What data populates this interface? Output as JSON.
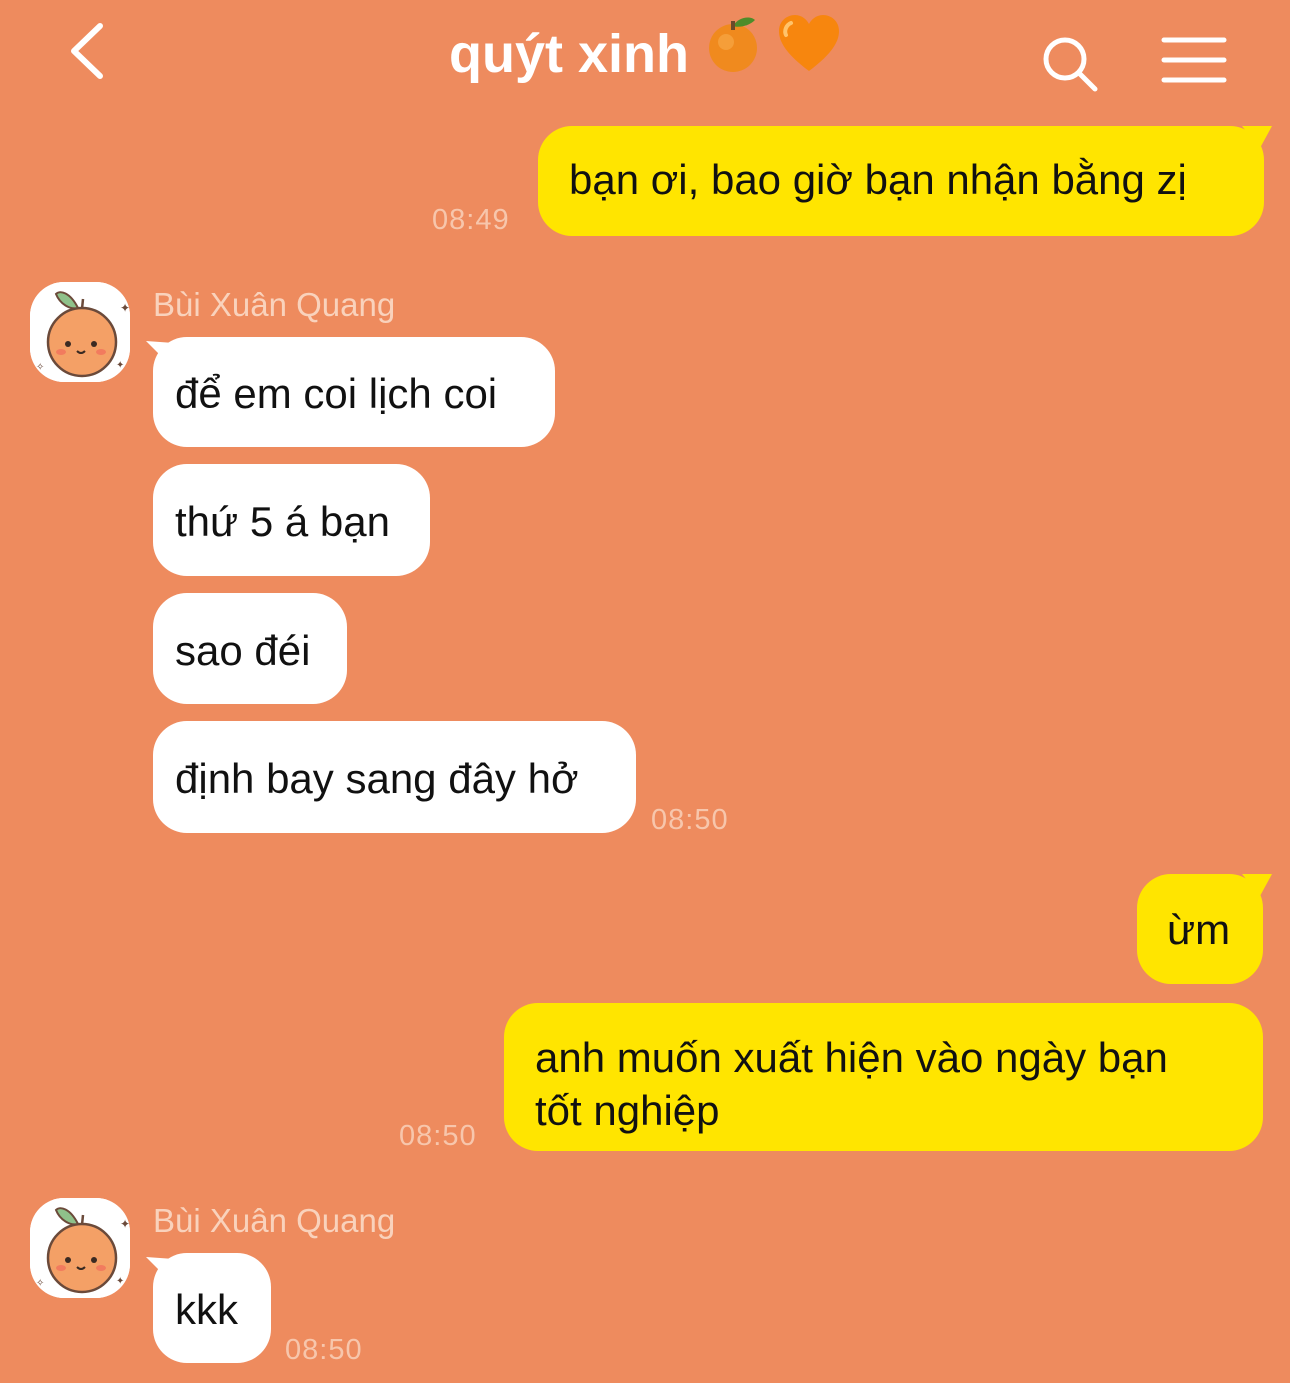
{
  "header": {
    "title": "quýt xinh",
    "title_emojis": "🍊 🧡",
    "back_icon": "chevron-left-icon",
    "search_icon": "search-icon",
    "menu_icon": "hamburger-menu-icon"
  },
  "colors": {
    "background": "#EE8B5E",
    "my_bubble": "#FFE500",
    "their_bubble": "#FFFFFF",
    "timestamp": "#F7C6AC",
    "sender_name": "#F9D2BC"
  },
  "messages": {
    "m1": {
      "text": "bạn ơi, bao giờ bạn nhận bằng zị",
      "time": "08:49"
    },
    "g1": {
      "sender": "Bùi Xuân Quang",
      "b1": "để em coi lịch coi",
      "b2": "thứ 5 á bạn",
      "b3": "sao đéi",
      "b4": "định bay sang đây hở",
      "time": "08:50"
    },
    "m2": {
      "text": "ừm"
    },
    "m3": {
      "line1": "anh muốn xuất hiện vào ngày bạn",
      "line2": "tốt nghiệp",
      "time": "08:50"
    },
    "g2": {
      "sender": "Bùi Xuân Quang",
      "b1": "kkk",
      "time": "08:50"
    }
  }
}
